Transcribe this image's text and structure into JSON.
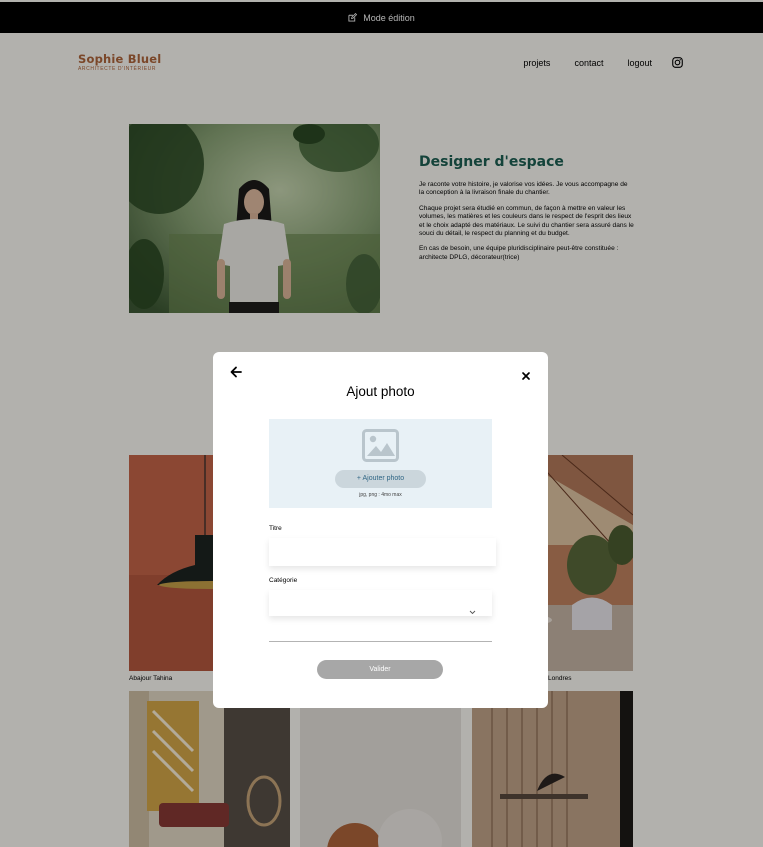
{
  "edit_bar": {
    "label": "Mode édition",
    "icon": "edit-icon"
  },
  "header": {
    "logo_name": "Sophie Bluel",
    "logo_subtitle": "ARCHITECTE D'INTÉRIEUR",
    "nav": [
      "projets",
      "contact",
      "logout"
    ],
    "social_icon": "instagram-icon"
  },
  "intro": {
    "title": "Designer d'espace",
    "paragraphs": [
      "Je raconte votre histoire, je valorise vos idées. Je vous accompagne de la conception à la livraison finale du chantier.",
      "Chaque projet sera étudié en commun, de façon à mettre en valeur les volumes, les matières et les couleurs dans le respect de l'esprit des lieux et le choix adapté des matériaux. Le suivi du chantier sera assuré dans le souci du détail, le respect du planning et du budget.",
      "En cas de besoin, une équipe pluridisciplinaire peut-être constituée : architecte DPLG, décorateur(trice)"
    ]
  },
  "gallery": {
    "captions": [
      "Abajour Tahina",
      "Londres"
    ]
  },
  "modal": {
    "title": "Ajout photo",
    "back_icon": "arrow-left-icon",
    "close_icon": "close-icon",
    "upload": {
      "icon": "image-placeholder-icon",
      "button_label": "+ Ajouter photo",
      "hint": "jpg, png : 4mo max"
    },
    "title_label": "Titre",
    "title_value": "",
    "category_label": "Catégorie",
    "category_value": "",
    "submit_label": "Valider"
  },
  "colors": {
    "brand": "#b1663c",
    "accent": "#1d6154",
    "upload_bg": "#e8f1f6",
    "upload_button_text": "#306685",
    "submit_disabled": "#a7a7a7"
  }
}
